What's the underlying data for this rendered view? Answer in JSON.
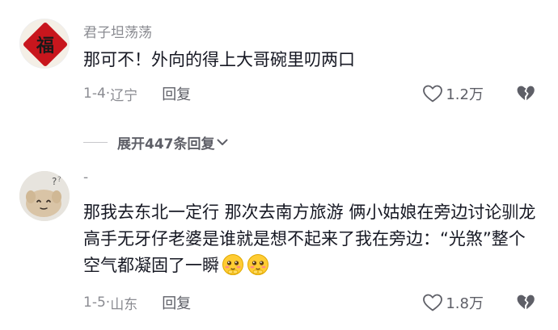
{
  "comments": [
    {
      "avatar_char": "福",
      "username": "君子坦荡荡",
      "text": "那可不！外向的得上大哥碗里叨两口",
      "date": "1-4",
      "location": "辽宁",
      "reply_label": "回复",
      "like_count": "1.2万"
    },
    {
      "username": "-",
      "text": "那我去东北一定行 那次去南方旅游 俩小姑娘在旁边讨论驯龙高手无牙仔老婆是谁就是想不起来了我在旁边：“光煞”整个空气都凝固了一瞬",
      "emojis": [
        "shy-emoji",
        "shy-emoji"
      ],
      "date": "1-5",
      "location": "山东",
      "reply_label": "回复",
      "like_count": "1.8万"
    }
  ],
  "expand_replies_label": "展开447条回复",
  "icons": {
    "like": "heart-outline-icon",
    "dislike": "broken-heart-icon",
    "expand": "chevron-down-icon"
  },
  "colors": {
    "text": "#161823",
    "muted": "#8a8b91",
    "avatar_red": "#c8161d"
  }
}
